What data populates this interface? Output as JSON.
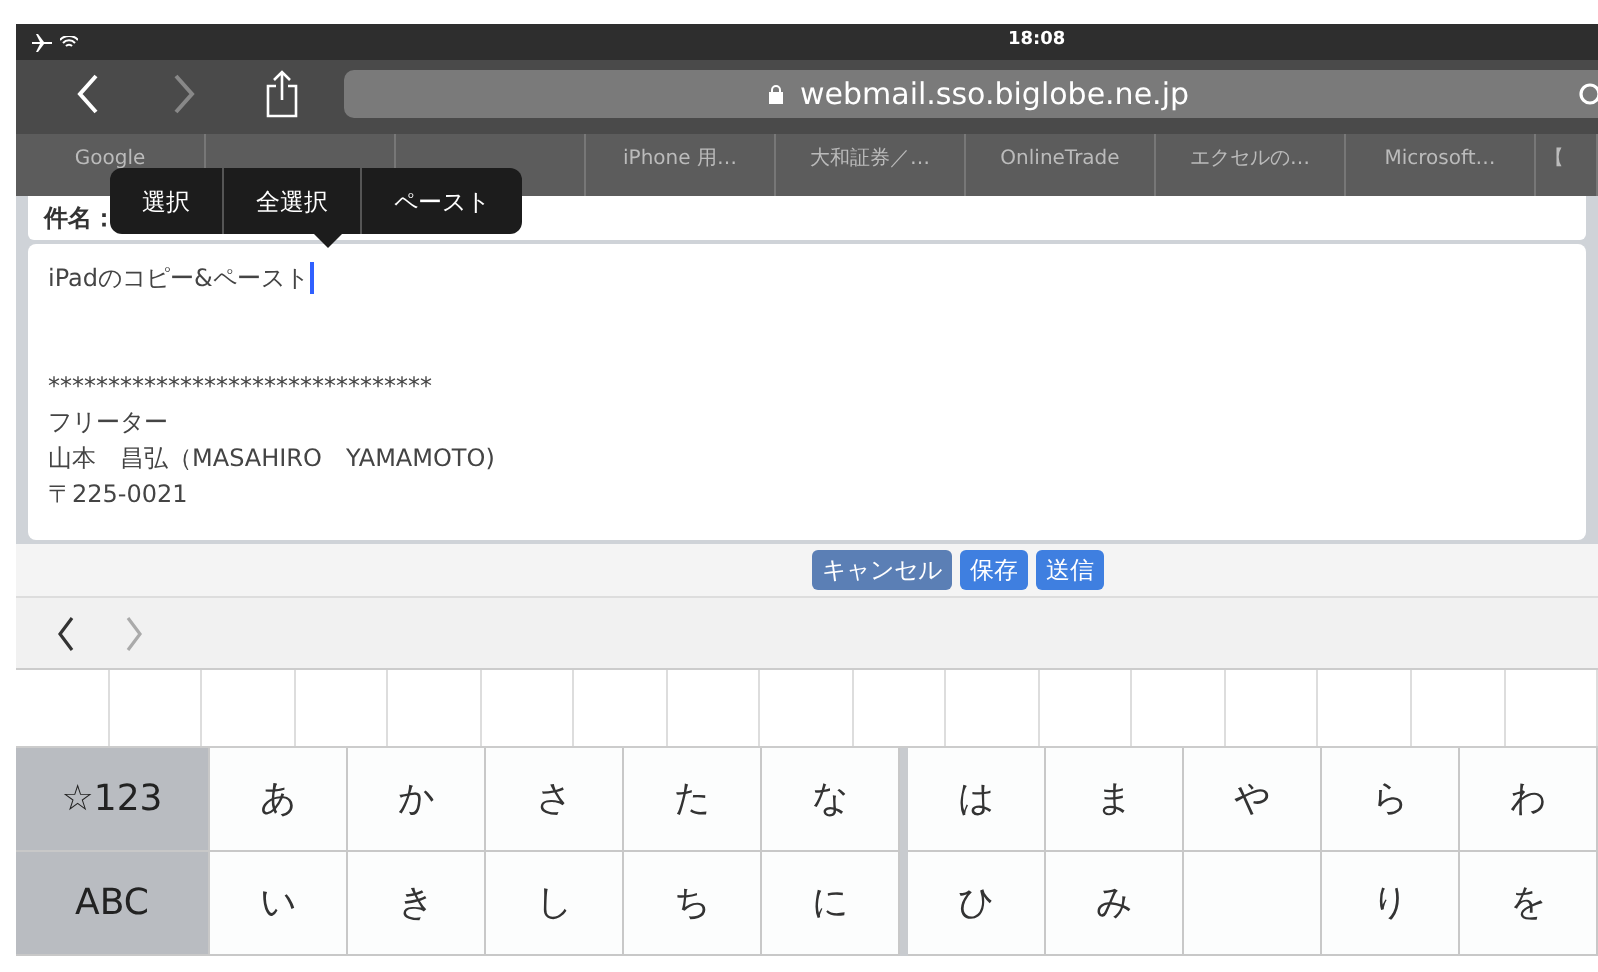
{
  "status_bar": {
    "time": "18:08"
  },
  "address_bar": {
    "url": "webmail.sso.biglobe.ne.jp"
  },
  "bookmarks": [
    {
      "kind": "link",
      "label": "Google"
    },
    {
      "kind": "covered"
    },
    {
      "kind": "covered"
    },
    {
      "kind": "link",
      "label": "iPhone 用…"
    },
    {
      "kind": "link",
      "label": "大和証券／…"
    },
    {
      "kind": "link",
      "label": "OnlineTrade"
    },
    {
      "kind": "link",
      "label": "エクセルの…"
    },
    {
      "kind": "link",
      "label": "Microsoft…"
    },
    {
      "kind": "link",
      "label": "【"
    }
  ],
  "edit_menu": [
    "選択",
    "全選択",
    "ペースト"
  ],
  "subject": {
    "label": "件名："
  },
  "body": {
    "lines": [
      {
        "kind": "text",
        "text": "iPadのコピー&ペースト"
      },
      {
        "kind": "blank"
      },
      {
        "kind": "blank"
      },
      {
        "kind": "text",
        "text": "********************************"
      },
      {
        "kind": "text",
        "text": "フリーター"
      },
      {
        "kind": "text",
        "text": "山本　昌弘（MASAHIRO　YAMAMOTO)"
      },
      {
        "kind": "text",
        "text": "〒225-0021"
      }
    ]
  },
  "buttons": [
    {
      "label": "キャンセル",
      "kind": "secondary"
    },
    {
      "label": "保存",
      "kind": "primary"
    },
    {
      "label": "送信",
      "kind": "primary"
    }
  ],
  "keyboard": {
    "rows": [
      [
        {
          "kind": "function",
          "label": "☆123"
        },
        {
          "kind": "kana",
          "label": "あ"
        },
        {
          "kind": "kana",
          "label": "か"
        },
        {
          "kind": "kana",
          "label": "さ"
        },
        {
          "kind": "kana",
          "label": "た"
        },
        {
          "kind": "kana",
          "label": "な"
        },
        {
          "kind": "kana",
          "label": "は"
        },
        {
          "kind": "kana",
          "label": "ま"
        },
        {
          "kind": "kana",
          "label": "や"
        },
        {
          "kind": "kana",
          "label": "ら"
        },
        {
          "kind": "kana",
          "label": "わ"
        }
      ],
      [
        {
          "kind": "function",
          "label": "ABC"
        },
        {
          "kind": "kana",
          "label": "い"
        },
        {
          "kind": "kana",
          "label": "き"
        },
        {
          "kind": "kana",
          "label": "し"
        },
        {
          "kind": "kana",
          "label": "ち"
        },
        {
          "kind": "kana",
          "label": "に"
        },
        {
          "kind": "kana",
          "label": "ひ"
        },
        {
          "kind": "kana",
          "label": "み"
        },
        {
          "kind": "blank"
        },
        {
          "kind": "kana",
          "label": "り"
        },
        {
          "kind": "kana",
          "label": "を"
        }
      ]
    ]
  }
}
